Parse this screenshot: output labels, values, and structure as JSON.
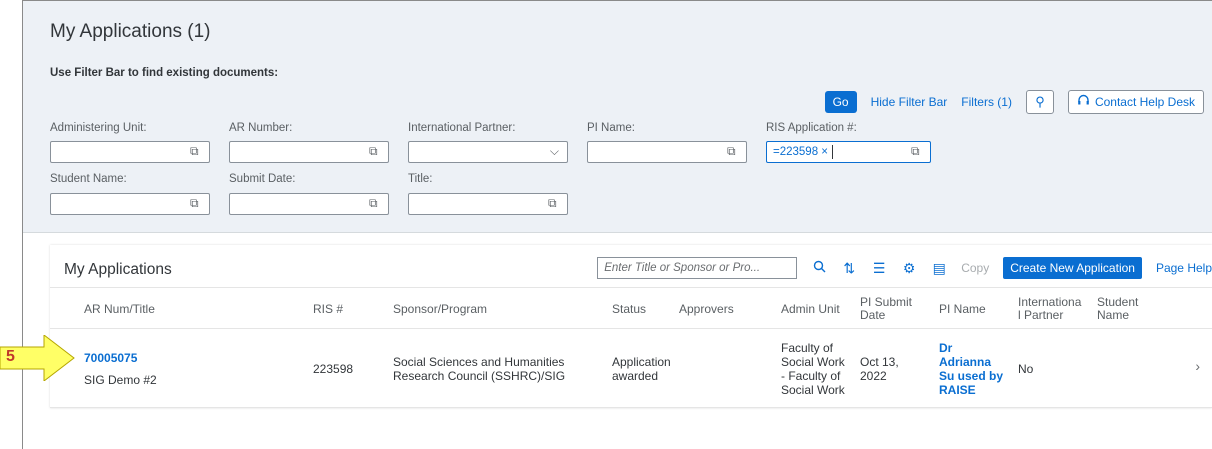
{
  "page": {
    "title": "My Applications (1)",
    "filter_hint": "Use Filter Bar to find existing documents:"
  },
  "toolbar": {
    "go": "Go",
    "hide_filter_bar": "Hide Filter Bar",
    "filters": "Filters (1)",
    "contact_help_desk": "Contact Help Desk"
  },
  "filters": {
    "administering_unit": "Administering Unit:",
    "ar_number": "AR Number:",
    "international_partner": "International Partner:",
    "pi_name": "PI Name:",
    "ris_application": "RIS Application #:",
    "ris_application_value": "=223598 ×",
    "student_name": "Student Name:",
    "submit_date": "Submit Date:",
    "title": "Title:"
  },
  "table": {
    "title": "My Applications",
    "search_placeholder": "Enter Title or Sponsor or Pro...",
    "copy": "Copy",
    "create_new": "Create New Application",
    "page_help": "Page Help",
    "columns": {
      "ar_num_title": "AR Num/Title",
      "ris": "RIS #",
      "sponsor": "Sponsor/Program",
      "status": "Status",
      "approvers": "Approvers",
      "admin_unit": "Admin Unit",
      "pi_submit_date": "PI Submit Date",
      "pi_name": "PI Name",
      "international_partner": "Internationa l Partner",
      "student_name": "Student Name"
    },
    "rows": [
      {
        "ar_num": "70005075",
        "title": "SIG Demo #2",
        "ris": "223598",
        "sponsor": "Social Sciences and Humanities Research Council (SSHRC)/SIG",
        "status": "Application awarded",
        "approvers": "",
        "admin_unit": "Faculty of Social Work - Faculty of Social Work",
        "pi_submit_date": "Oct 13, 2022",
        "pi_name": "Dr Adrianna Su used by RAISE",
        "international_partner": "No",
        "student_name": ""
      }
    ]
  },
  "callout": {
    "number": "5",
    "fill": "#ffff66",
    "text_color": "#c0392b"
  },
  "colors": {
    "accent": "#0a6ed1",
    "filter_bg": "#edf1f6"
  },
  "icons": [
    "value-help-icon",
    "chevron-down-icon",
    "search-icon",
    "sort-icon",
    "group-icon",
    "settings-icon",
    "export-icon",
    "personalize-icon",
    "headset-icon",
    "chevron-right-icon"
  ]
}
